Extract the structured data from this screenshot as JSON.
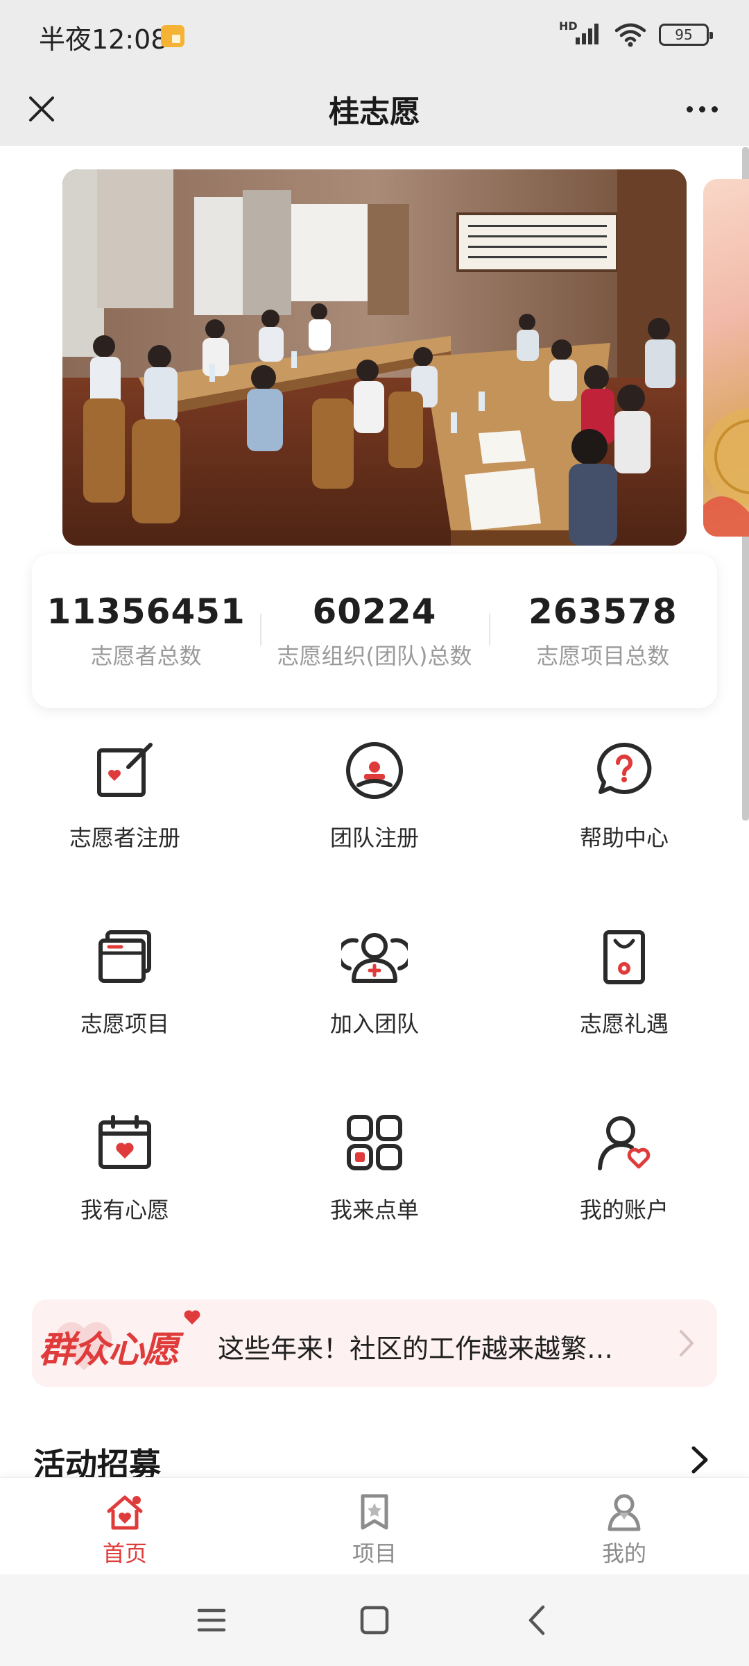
{
  "status_bar": {
    "time": "半夜12:08",
    "network_label": "HD",
    "battery": "95"
  },
  "title_bar": {
    "title": "桂志愿",
    "close_icon": "close-icon",
    "more_icon": "more-dots-icon"
  },
  "banner": {
    "image": "photo of a meeting room with people seated at long conference tables"
  },
  "stats": [
    {
      "value": "11356451",
      "label": "志愿者总数"
    },
    {
      "value": "60224",
      "label": "志愿组织(团队)总数"
    },
    {
      "value": "263578",
      "label": "志愿项目总数"
    }
  ],
  "grid": [
    {
      "label": "志愿者注册",
      "icon": "register-edit-icon"
    },
    {
      "label": "团队注册",
      "icon": "team-stamp-icon"
    },
    {
      "label": "帮助中心",
      "icon": "help-question-icon"
    },
    {
      "label": "志愿项目",
      "icon": "project-window-icon"
    },
    {
      "label": "加入团队",
      "icon": "join-team-icon"
    },
    {
      "label": "志愿礼遇",
      "icon": "gift-bag-icon"
    },
    {
      "label": "我有心愿",
      "icon": "calendar-heart-icon"
    },
    {
      "label": "我来点单",
      "icon": "apps-grid-icon"
    },
    {
      "label": "我的账户",
      "icon": "user-heart-icon"
    }
  ],
  "notice": {
    "brand": "群众心愿",
    "text": "这些年来！社区的工作越来越繁…"
  },
  "section": {
    "title": "活动招募"
  },
  "tabs": [
    {
      "label": "首页",
      "icon": "home-icon",
      "active": true
    },
    {
      "label": "项目",
      "icon": "project-badge-icon",
      "active": false
    },
    {
      "label": "我的",
      "icon": "user-icon",
      "active": false
    }
  ],
  "colors": {
    "accent": "#e03b3b",
    "header_bg": "#ececec",
    "muted_text": "#9a9a9a"
  }
}
